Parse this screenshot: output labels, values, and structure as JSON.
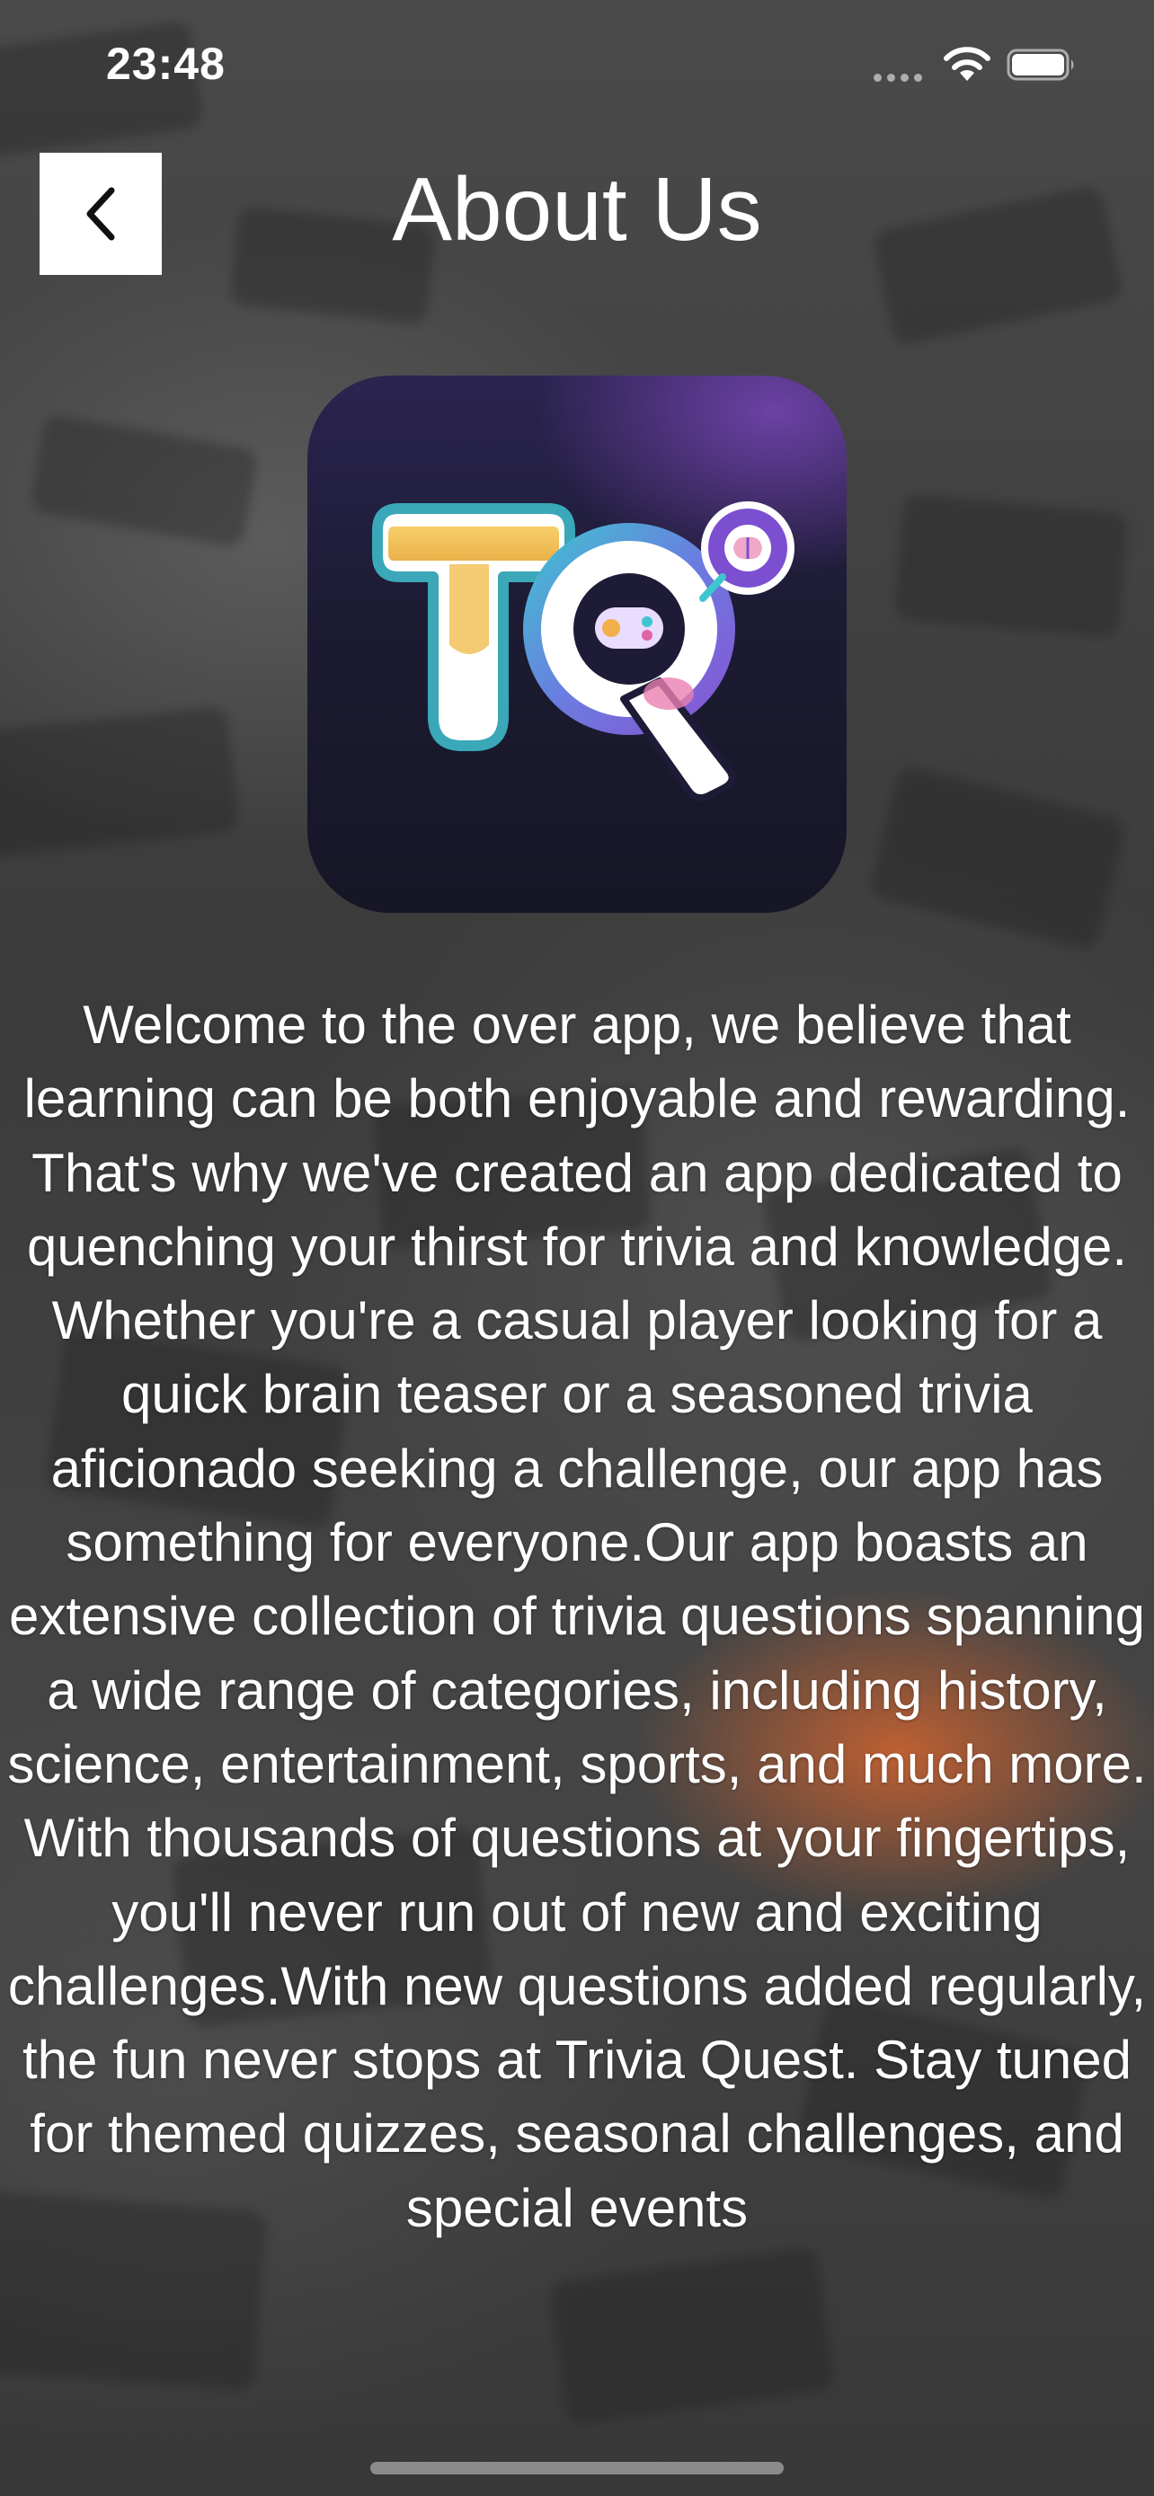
{
  "status_bar": {
    "time": "23:48",
    "wifi_icon": "wifi-icon",
    "battery_icon": "battery-icon"
  },
  "header": {
    "back_icon": "chevron-left-icon",
    "title": "About Us"
  },
  "logo": {
    "icon": "trivia-quest-logo",
    "letters": "TQ"
  },
  "about": {
    "body": "Welcome to the over app, we believe that learning can be both enjoyable and rewarding. That's why we've created an app dedicated to quenching your thirst for trivia and knowledge. Whether you're a casual player looking for a quick brain teaser or a seasoned trivia aficionado seeking a challenge, our app has something for everyone.Our app boasts an extensive collection of trivia questions spanning a wide range of categories, including history, science, entertainment, sports, and much more. With thousands of questions at your fingertips, you'll never run out of new and exciting challenges.With new questions added regularly, the fun never stops at Trivia Quest. Stay tuned for themed quizzes, seasonal challenges, and special events"
  },
  "colors": {
    "title": "#ffffff",
    "back_button_bg": "#ffffff",
    "logo_bg": "#1c1b33",
    "logo_t_yellow": "#f2c25a",
    "logo_t_outline": "#3aa8b8",
    "logo_q_purple": "#7b4fd0"
  }
}
